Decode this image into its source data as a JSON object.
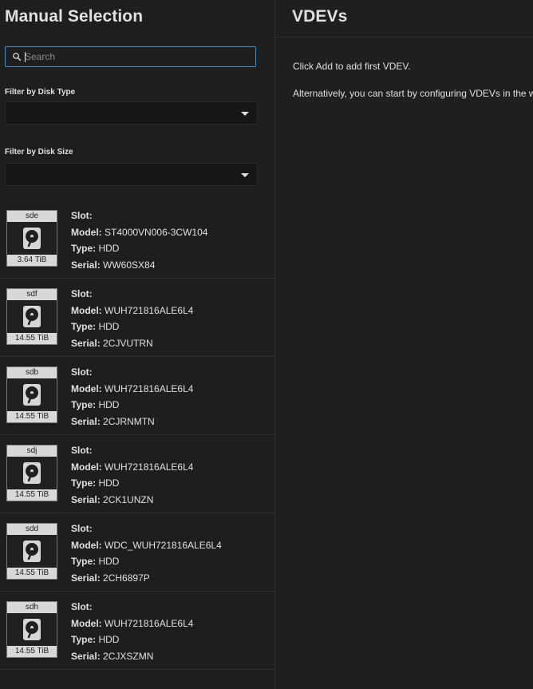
{
  "manual_selection": {
    "title": "Manual Selection",
    "search": {
      "placeholder": "Search",
      "value": ""
    },
    "filter_disk_type": {
      "label": "Filter by Disk Type",
      "value": ""
    },
    "filter_disk_size": {
      "label": "Filter by Disk Size",
      "value": ""
    },
    "field_labels": {
      "slot": "Slot:",
      "model": "Model:",
      "type": "Type:",
      "serial": "Serial:"
    },
    "disks": [
      {
        "name": "sde",
        "size": "3.64 TiB",
        "slot": "",
        "model": "ST4000VN006-3CW104",
        "type": "HDD",
        "serial": "WW60SX84"
      },
      {
        "name": "sdf",
        "size": "14.55 TiB",
        "slot": "",
        "model": "WUH721816ALE6L4",
        "type": "HDD",
        "serial": "2CJVUTRN"
      },
      {
        "name": "sdb",
        "size": "14.55 TiB",
        "slot": "",
        "model": "WUH721816ALE6L4",
        "type": "HDD",
        "serial": "2CJRNMTN"
      },
      {
        "name": "sdj",
        "size": "14.55 TiB",
        "slot": "",
        "model": "WUH721816ALE6L4",
        "type": "HDD",
        "serial": "2CK1UNZN"
      },
      {
        "name": "sdd",
        "size": "14.55 TiB",
        "slot": "",
        "model": "WDC_WUH721816ALE6L4",
        "type": "HDD",
        "serial": "2CH6897P"
      },
      {
        "name": "sdh",
        "size": "14.55 TiB",
        "slot": "",
        "model": "WUH721816ALE6L4",
        "type": "HDD",
        "serial": "2CJXSZMN"
      }
    ]
  },
  "vdevs": {
    "title": "VDEVs",
    "hint_add": "Click Add to add first VDEV.",
    "hint_wizard": "Alternatively, you can start by configuring VDEVs in the wizard"
  },
  "icons": {
    "search": "search-icon",
    "dropdown": "chevron-down-icon",
    "disk": "hard-drive-icon"
  },
  "colors": {
    "background": "#1e1e1e",
    "focus_border": "#4a88c2",
    "disk_label_bg": "#d8d8d8"
  }
}
